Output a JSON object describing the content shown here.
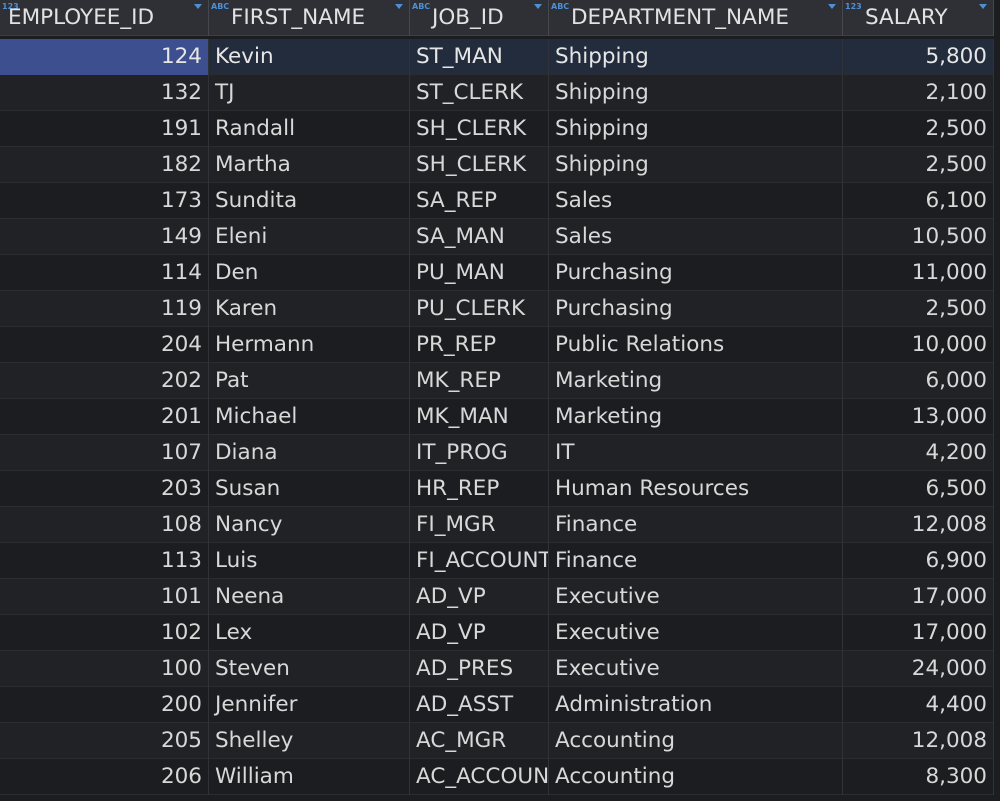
{
  "columns": [
    {
      "name": "EMPLOYEE_ID",
      "type_icon": "123",
      "align": "num"
    },
    {
      "name": "FIRST_NAME",
      "type_icon": "ABC",
      "align": "txt"
    },
    {
      "name": "JOB_ID",
      "type_icon": "ABC",
      "align": "txt"
    },
    {
      "name": "DEPARTMENT_NAME",
      "type_icon": "ABC",
      "align": "txt"
    },
    {
      "name": "SALARY",
      "type_icon": "123",
      "align": "num"
    }
  ],
  "rows": [
    [
      "124",
      "Kevin",
      "ST_MAN",
      "Shipping",
      "5,800"
    ],
    [
      "132",
      "TJ",
      "ST_CLERK",
      "Shipping",
      "2,100"
    ],
    [
      "191",
      "Randall",
      "SH_CLERK",
      "Shipping",
      "2,500"
    ],
    [
      "182",
      "Martha",
      "SH_CLERK",
      "Shipping",
      "2,500"
    ],
    [
      "173",
      "Sundita",
      "SA_REP",
      "Sales",
      "6,100"
    ],
    [
      "149",
      "Eleni",
      "SA_MAN",
      "Sales",
      "10,500"
    ],
    [
      "114",
      "Den",
      "PU_MAN",
      "Purchasing",
      "11,000"
    ],
    [
      "119",
      "Karen",
      "PU_CLERK",
      "Purchasing",
      "2,500"
    ],
    [
      "204",
      "Hermann",
      "PR_REP",
      "Public Relations",
      "10,000"
    ],
    [
      "202",
      "Pat",
      "MK_REP",
      "Marketing",
      "6,000"
    ],
    [
      "201",
      "Michael",
      "MK_MAN",
      "Marketing",
      "13,000"
    ],
    [
      "107",
      "Diana",
      "IT_PROG",
      "IT",
      "4,200"
    ],
    [
      "203",
      "Susan",
      "HR_REP",
      "Human Resources",
      "6,500"
    ],
    [
      "108",
      "Nancy",
      "FI_MGR",
      "Finance",
      "12,008"
    ],
    [
      "113",
      "Luis",
      "FI_ACCOUNT",
      "Finance",
      "6,900"
    ],
    [
      "101",
      "Neena",
      "AD_VP",
      "Executive",
      "17,000"
    ],
    [
      "102",
      "Lex",
      "AD_VP",
      "Executive",
      "17,000"
    ],
    [
      "100",
      "Steven",
      "AD_PRES",
      "Executive",
      "24,000"
    ],
    [
      "200",
      "Jennifer",
      "AD_ASST",
      "Administration",
      "4,400"
    ],
    [
      "205",
      "Shelley",
      "AC_MGR",
      "Accounting",
      "12,008"
    ],
    [
      "206",
      "William",
      "AC_ACCOUNT",
      "Accounting",
      "8,300"
    ]
  ],
  "selected_row": 0,
  "colors": {
    "background": "#1b1d20",
    "header": "#2e3035",
    "selection": "#3d4f8f",
    "type_icon": "#4f8fd6"
  }
}
